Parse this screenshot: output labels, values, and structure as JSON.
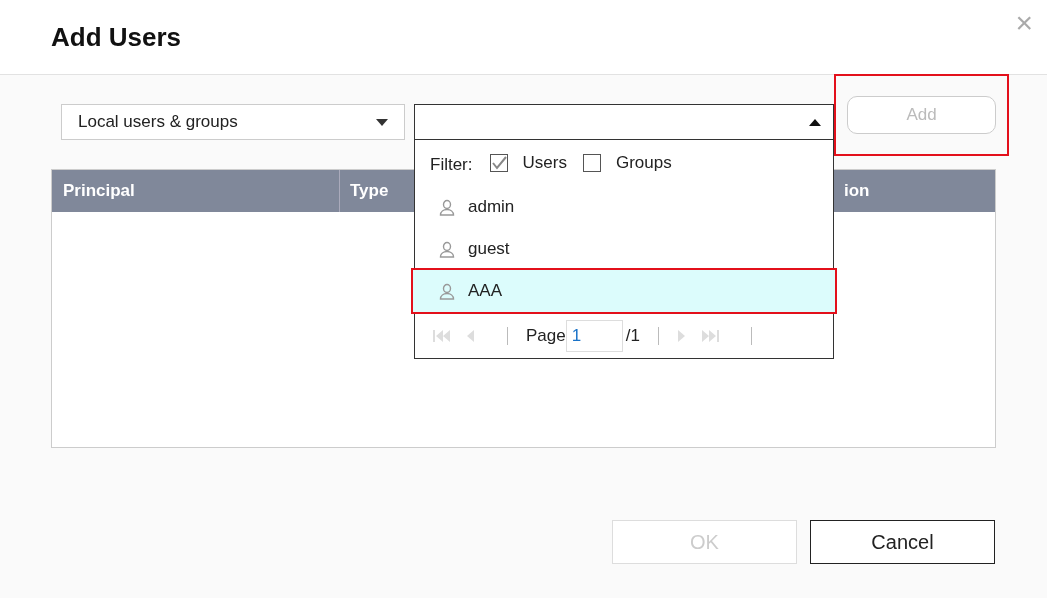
{
  "dialog": {
    "title": "Add Users",
    "close": "×"
  },
  "source_select": {
    "value": "Local users & groups"
  },
  "user_picker": {
    "expanded": true,
    "filter": {
      "label": "Filter:",
      "options": [
        {
          "label": "Users",
          "checked": true
        },
        {
          "label": "Groups",
          "checked": false
        }
      ]
    },
    "items": [
      {
        "name": "admin",
        "selected": false,
        "annotated": false
      },
      {
        "name": "guest",
        "selected": false,
        "annotated": false
      },
      {
        "name": "AAA",
        "selected": true,
        "annotated": true
      }
    ],
    "pager": {
      "label": "Page",
      "page": "1",
      "total": "/1"
    }
  },
  "add_button": {
    "label": "Add",
    "disabled": true,
    "annotated": true
  },
  "table": {
    "columns": [
      {
        "label": "Principal"
      },
      {
        "label": "Type"
      },
      {
        "label": "ion"
      }
    ]
  },
  "buttons": [
    {
      "label": "OK",
      "disabled": true
    },
    {
      "label": "Cancel",
      "disabled": false
    }
  ]
}
